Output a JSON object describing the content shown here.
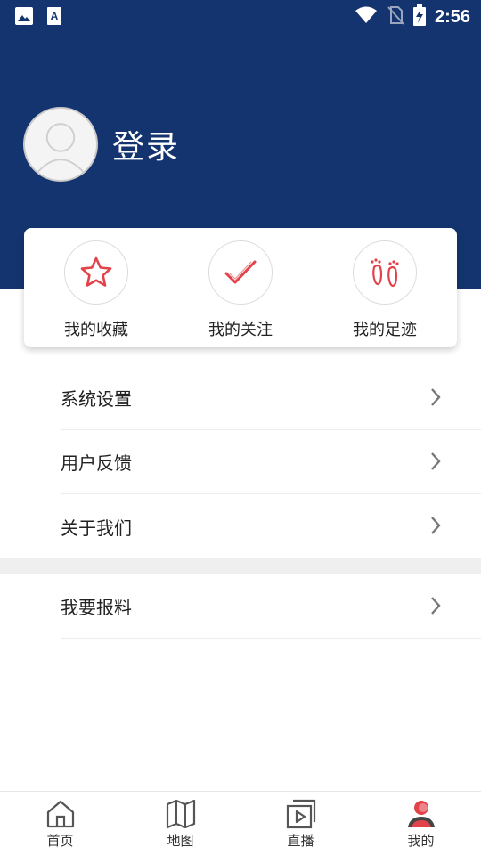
{
  "status_bar": {
    "time": "2:56"
  },
  "profile": {
    "login_label": "登录"
  },
  "quick_actions": [
    {
      "label": "我的收藏",
      "icon": "star-icon"
    },
    {
      "label": "我的关注",
      "icon": "check-icon"
    },
    {
      "label": "我的足迹",
      "icon": "footprint-icon"
    }
  ],
  "menu": [
    {
      "label": "系统设置"
    },
    {
      "label": "用户反馈"
    },
    {
      "label": "关于我们"
    }
  ],
  "menu2": [
    {
      "label": "我要报料"
    }
  ],
  "tabs": [
    {
      "label": "首页",
      "icon": "home-icon"
    },
    {
      "label": "地图",
      "icon": "map-icon"
    },
    {
      "label": "直播",
      "icon": "play-icon"
    },
    {
      "label": "我的",
      "icon": "user-icon",
      "active": true
    }
  ],
  "colors": {
    "header": "#13346e",
    "accent": "#e2434b"
  }
}
